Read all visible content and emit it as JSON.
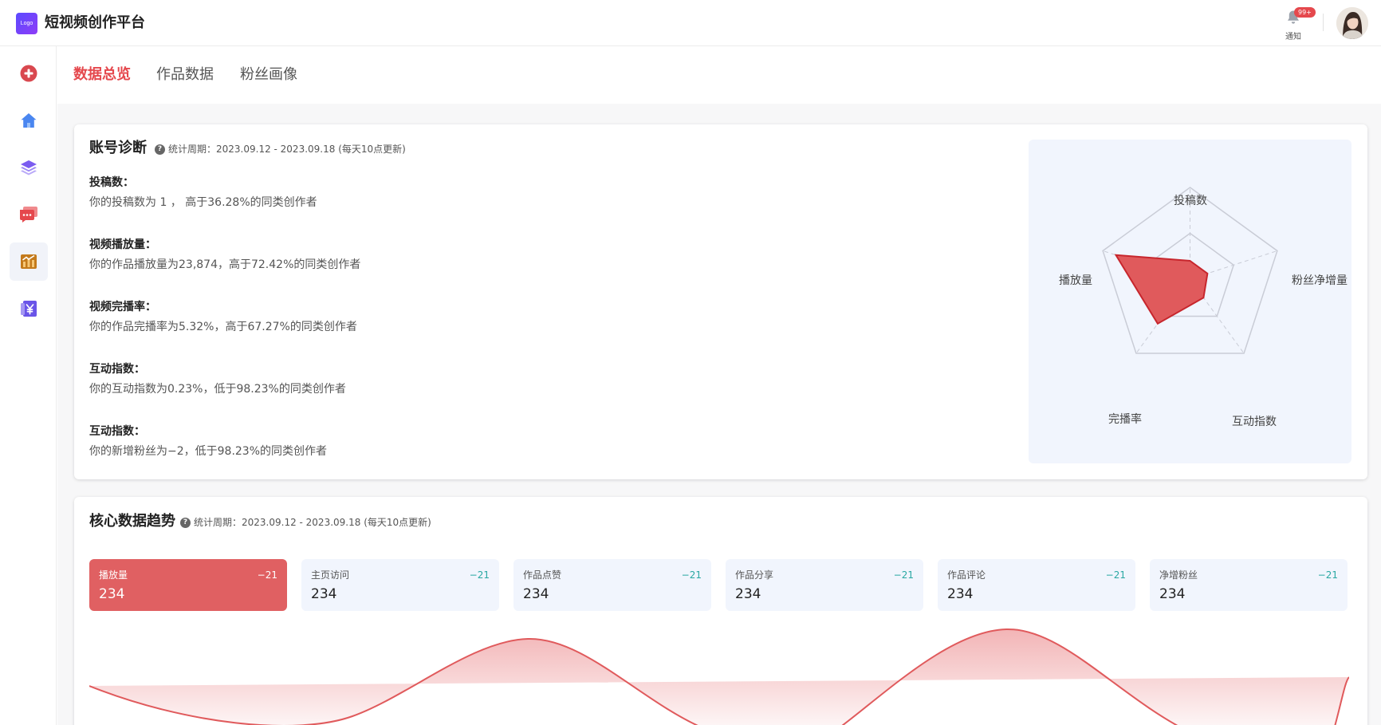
{
  "header": {
    "logo_text": "Logo",
    "app_title": "短视频创作平台",
    "notification_badge": "99+",
    "notification_label": "通知"
  },
  "sidebar": {
    "items": [
      {
        "icon": "plus-circle-icon",
        "color": "#d9484f"
      },
      {
        "icon": "home-icon",
        "color": "#4a86f0"
      },
      {
        "icon": "layers-icon",
        "color": "#7b5cf0"
      },
      {
        "icon": "chat-icon",
        "color": "#e5484d"
      },
      {
        "icon": "chart-icon",
        "color": "#c47a1b",
        "active": true
      },
      {
        "icon": "yuan-icon",
        "color": "#6a55e8"
      }
    ]
  },
  "tabs": [
    {
      "label": "数据总览",
      "active": true
    },
    {
      "label": "作品数据",
      "active": false
    },
    {
      "label": "粉丝画像",
      "active": false
    }
  ],
  "diagnosis": {
    "title": "账号诊断",
    "period": "统计周期：2023.09.12 - 2023.09.18 (每天10点更新)",
    "items": [
      {
        "label": "投稿数：",
        "text": "你的投稿数为 1 ，  高于36.28%的同类创作者"
      },
      {
        "label": "视频播放量：",
        "text": "你的作品播放量为23,874，高于72.42%的同类创作者"
      },
      {
        "label": "视频完播率：",
        "text": "你的作品完播率为5.32%，高于67.27%的同类创作者"
      },
      {
        "label": "互动指数：",
        "text": "你的互动指数为0.23%，低于98.23%的同类创作者"
      },
      {
        "label": "互动指数：",
        "text": "你的新增粉丝为−2，低于98.23%的同类创作者"
      }
    ],
    "radar": {
      "axes": [
        "投稿数",
        "粉丝净增量",
        "互动指数",
        "完播率",
        "播放量"
      ],
      "values": [
        0.2,
        0.2,
        0.25,
        0.6,
        0.85
      ],
      "fill_color": "#e05a5c",
      "stroke_color": "#c7262d"
    }
  },
  "trend": {
    "title": "核心数据趋势",
    "period": "统计周期：2023.09.12 - 2023.09.18 (每天10点更新)",
    "metrics": [
      {
        "name": "播放量",
        "value": "234",
        "delta": "−21",
        "active": true
      },
      {
        "name": "主页访问",
        "value": "234",
        "delta": "−21",
        "active": false
      },
      {
        "name": "作品点赞",
        "value": "234",
        "delta": "−21",
        "active": false
      },
      {
        "name": "作品分享",
        "value": "234",
        "delta": "−21",
        "active": false
      },
      {
        "name": "作品评论",
        "value": "234",
        "delta": "−21",
        "active": false
      },
      {
        "name": "净增粉丝",
        "value": "234",
        "delta": "−21",
        "active": false
      }
    ],
    "line_color": "#e05a5c"
  }
}
